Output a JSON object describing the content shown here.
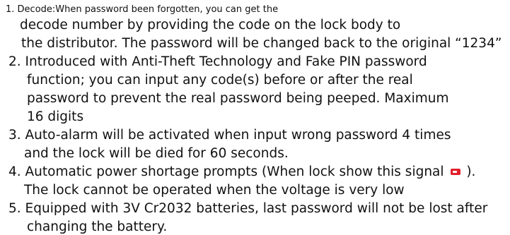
{
  "item1": {
    "line1": "1. Decode:When password been forgotten, you can get the",
    "line2": "decode number by providing the code on the lock body to",
    "line3": "the distributor. The password  will be changed back to the original “1234”"
  },
  "item2": {
    "line1": "2.  Introduced with Anti-Theft Technology and Fake PIN password",
    "line2": "function; you can input any code(s) before or after the real",
    "line3": "password to prevent the real password being peeped. Maximum",
    "line4": "16 digits"
  },
  "item3": {
    "line1": "3.  Auto-alarm will be activated when input wrong password 4 times",
    "line2": "and the lock will be died for 60 seconds."
  },
  "item4": {
    "line1_before": "4.   Automatic power shortage prompts (When lock show this signal",
    "line1_after": ").",
    "line2": "The lock cannot be operated when the voltage is very low",
    "icon": "low-battery-icon",
    "icon_color": "#e0202a"
  },
  "item5": {
    "line1": "5.  Equipped with 3V Cr2032 batteries, last password will not be lost after",
    "line2": "changing the battery."
  }
}
